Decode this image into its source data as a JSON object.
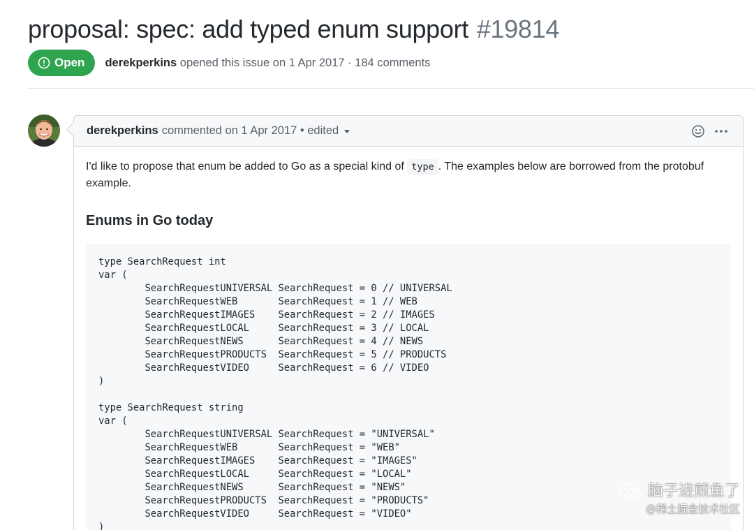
{
  "issue": {
    "title": "proposal: spec: add typed enum support",
    "number": "#19814",
    "state": "Open",
    "author": "derekperkins",
    "meta": "opened this issue on 1 Apr 2017 · 184 comments"
  },
  "comment": {
    "author": "derekperkins",
    "meta": "commented on 1 Apr 2017 • edited",
    "actions": {
      "reaction_icon": "smiley-icon",
      "more_icon": "kebab-horizontal-icon"
    },
    "body": {
      "intro_before": "I'd like to propose that enum be added to Go as a special kind of ",
      "intro_code": "type",
      "intro_after": ". The examples below are borrowed from the protobuf example.",
      "heading": "Enums in Go today",
      "code_lines": [
        "type SearchRequest int",
        "var (",
        "        SearchRequestUNIVERSAL SearchRequest = 0 // UNIVERSAL",
        "        SearchRequestWEB       SearchRequest = 1 // WEB",
        "        SearchRequestIMAGES    SearchRequest = 2 // IMAGES",
        "        SearchRequestLOCAL     SearchRequest = 3 // LOCAL",
        "        SearchRequestNEWS      SearchRequest = 4 // NEWS",
        "        SearchRequestPRODUCTS  SearchRequest = 5 // PRODUCTS",
        "        SearchRequestVIDEO     SearchRequest = 6 // VIDEO",
        ")",
        "",
        "type SearchRequest string",
        "var (",
        "        SearchRequestUNIVERSAL SearchRequest = \"UNIVERSAL\"",
        "        SearchRequestWEB       SearchRequest = \"WEB\"",
        "        SearchRequestIMAGES    SearchRequest = \"IMAGES\"",
        "        SearchRequestLOCAL     SearchRequest = \"LOCAL\"",
        "        SearchRequestNEWS      SearchRequest = \"NEWS\"",
        "        SearchRequestPRODUCTS  SearchRequest = \"PRODUCTS\"",
        "        SearchRequestVIDEO     SearchRequest = \"VIDEO\"",
        ")"
      ]
    }
  },
  "watermark": {
    "line1": "脑子进煎鱼了",
    "line2": "@稀土掘金技术社区"
  },
  "colors": {
    "open_badge": "#2ea44f",
    "muted_text": "#586069",
    "code_bg": "#f6f8fa",
    "border": "#d1d5da"
  }
}
